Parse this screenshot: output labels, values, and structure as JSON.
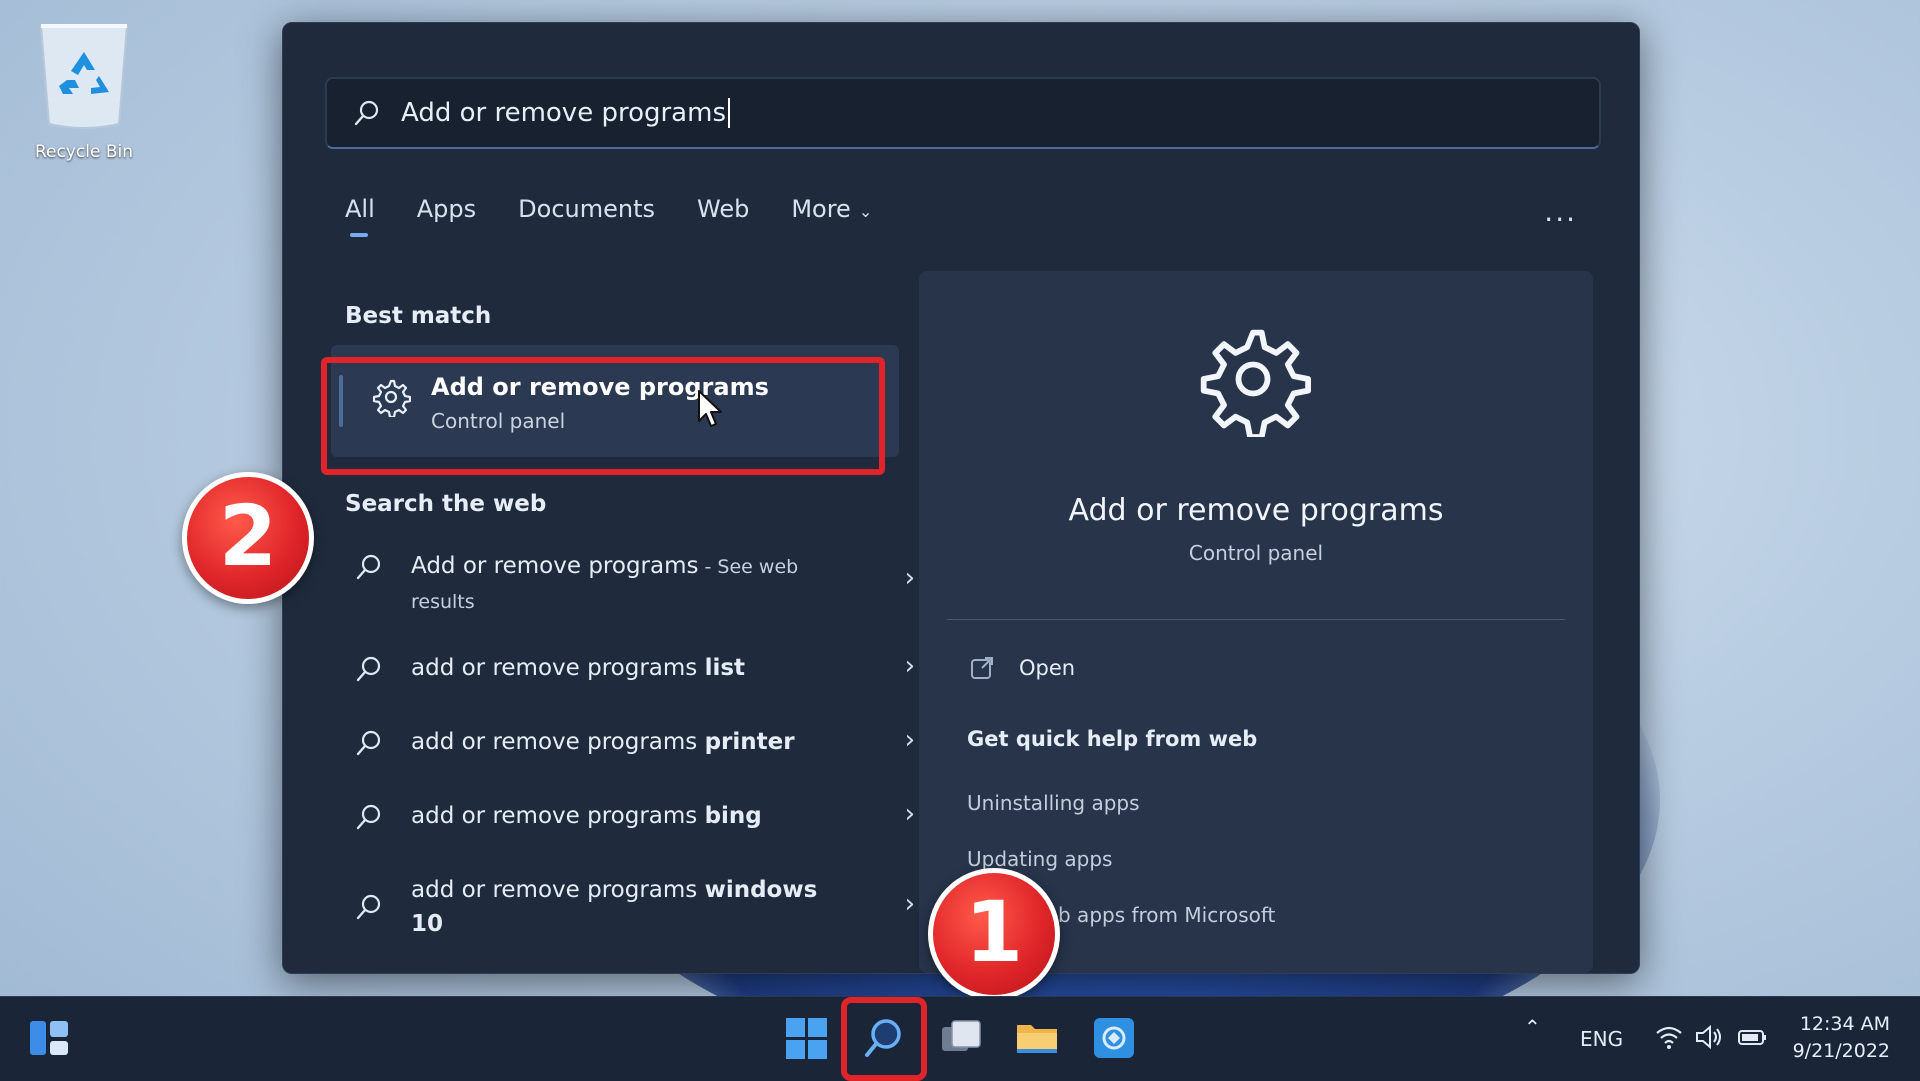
{
  "desktop": {
    "recycle_bin_label": "Recycle Bin"
  },
  "search": {
    "query": "Add or remove programs"
  },
  "tabs": [
    {
      "label": "All",
      "active": true
    },
    {
      "label": "Apps"
    },
    {
      "label": "Documents"
    },
    {
      "label": "Web"
    },
    {
      "label": "More"
    }
  ],
  "more_options_label": "...",
  "best_match": {
    "heading": "Best match",
    "title": "Add or remove programs",
    "subtitle": "Control panel"
  },
  "search_web": {
    "heading": "Search the web",
    "items": [
      {
        "prefix": "Add or remove programs",
        "suffix": " - See web",
        "extra": "results"
      },
      {
        "prefix": "add or remove programs ",
        "bold": "list"
      },
      {
        "prefix": "add or remove programs ",
        "bold": "printer"
      },
      {
        "prefix": "add or remove programs ",
        "bold": "bing"
      },
      {
        "prefix": "add or remove programs ",
        "bold": "windows",
        "extra": "10"
      }
    ]
  },
  "detail": {
    "title": "Add or remove programs",
    "subtitle": "Control panel",
    "open_label": "Open",
    "help_heading": "Get quick help from web",
    "links": [
      "Uninstalling apps",
      "Updating apps",
      "Using web apps from Microsoft"
    ]
  },
  "badges": {
    "one": "1",
    "two": "2"
  },
  "taskbar": {
    "language": "ENG",
    "time": "12:34 AM",
    "date": "9/21/2022"
  },
  "colors": {
    "highlight_red": "#e0242a",
    "panel_bg": "#1f2b3d",
    "accent_blue": "#7aaaf0"
  }
}
